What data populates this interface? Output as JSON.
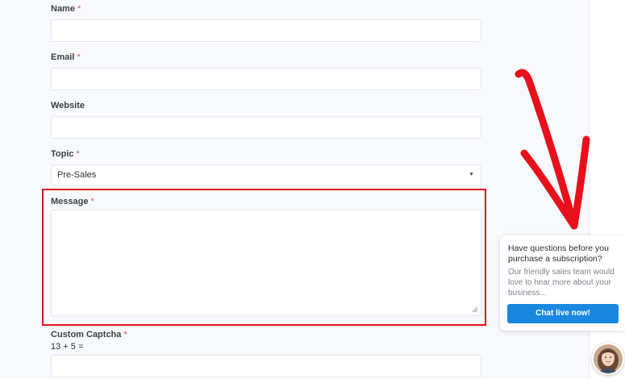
{
  "form": {
    "name_label": "Name",
    "email_label": "Email",
    "website_label": "Website",
    "topic_label": "Topic",
    "topic_selected": "Pre-Sales",
    "message_label": "Message",
    "captcha_label": "Custom Captcha",
    "captcha_question": "13 + 5 =",
    "required_marker": "*"
  },
  "chat_widget": {
    "headline": "Have questions before you purchase a subscription?",
    "body": "Our friendly sales team would love to hear more about your business...",
    "button_label": "Chat live now!"
  },
  "colors": {
    "highlight": "#e0121c",
    "required": "#e2564f",
    "chat_button": "#1a87e0",
    "form_background": "#f7f9fd"
  },
  "icons": {
    "select_caret": "▼",
    "annotation": "hand-drawn-red-arrow",
    "avatar": "support-agent-photo"
  }
}
